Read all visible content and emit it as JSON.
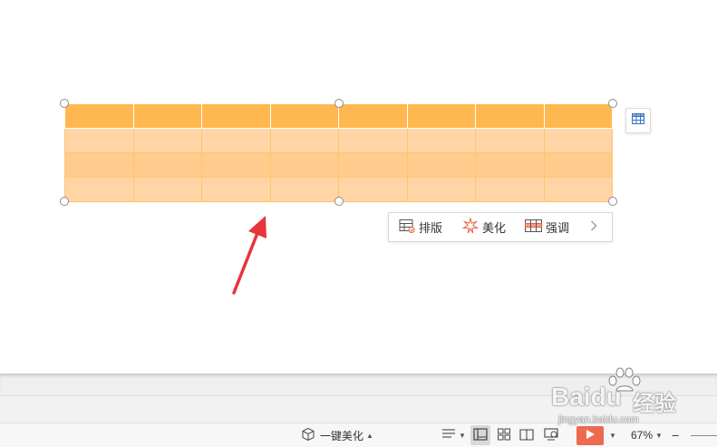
{
  "toolbar": {
    "layout_label": "排版",
    "beautify_label": "美化",
    "emphasize_label": "强调"
  },
  "statusbar": {
    "one_click_beautify": "一键美化",
    "zoom": "67%",
    "zoom_out": "−"
  },
  "watermark": {
    "brand": "Baidu",
    "brand_cn": "经验",
    "domain": "jingyan.baidu.com"
  },
  "colors": {
    "table_header": "#ffb74f",
    "table_body": "#ffd5a5",
    "accent_arrow": "#e8353b",
    "play_button": "#ee6a4f"
  }
}
